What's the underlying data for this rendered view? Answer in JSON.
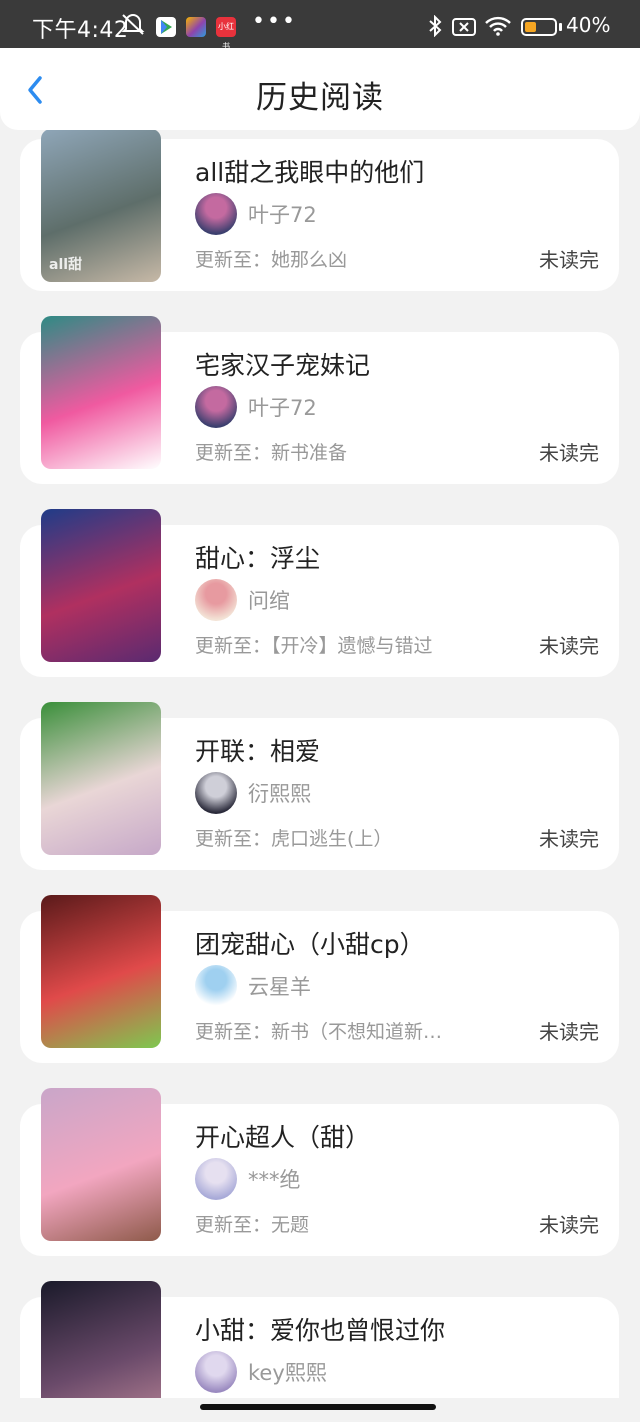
{
  "status_bar": {
    "time": "下午4:42",
    "battery_pct": "40%",
    "battery_level": 0.4,
    "mini_app_label": "小红书"
  },
  "header": {
    "title": "历史阅读"
  },
  "colors": {
    "accent": "#2d8cf0",
    "background": "#f2f2f2"
  },
  "books": [
    {
      "title": "all甜之我眼中的他们",
      "author": "叶子72",
      "update": "更新至：她那么凶",
      "status": "未读完",
      "cover": [
        "#8fa6b8",
        "#5e6e6a",
        "#c7b9a7"
      ],
      "cover_text": "all甜",
      "avatar": [
        "#3b3f6e",
        "#c46aa0"
      ]
    },
    {
      "title": "宅家汉子宠妹记",
      "author": "叶子72",
      "update": "更新至：新书准备",
      "status": "未读完",
      "cover": [
        "#2e8b84",
        "#f05aa0",
        "#ffffff"
      ],
      "cover_text": "",
      "avatar": [
        "#3b3f6e",
        "#c46aa0"
      ]
    },
    {
      "title": "甜心：浮尘",
      "author": "问绾",
      "update": "更新至：【开冷】遗憾与错过",
      "status": "未读完",
      "cover": [
        "#1f3c88",
        "#b03060",
        "#5a2a70"
      ],
      "cover_text": "",
      "avatar": [
        "#f3e3d6",
        "#e79aa0"
      ]
    },
    {
      "title": "开联：相爱",
      "author": "衍熙熙",
      "update": "更新至：虎口逃生(上）",
      "status": "未读完",
      "cover": [
        "#3a8f3a",
        "#e9d6d6",
        "#c6a8c8"
      ],
      "cover_text": "",
      "avatar": [
        "#2a2a3a",
        "#cfcfd8"
      ]
    },
    {
      "title": "团宠甜心（小甜cp）",
      "author": "云星羊",
      "update": "更新至：新书（不想知道新…",
      "status": "未读完",
      "cover": [
        "#5a1a1a",
        "#e04a4a",
        "#7ec850"
      ],
      "cover_text": "",
      "avatar": [
        "#ffffff",
        "#9fd0f0"
      ]
    },
    {
      "title": "开心超人（甜）",
      "author": "***绝",
      "update": "更新至：无题",
      "status": "未读完",
      "cover": [
        "#c9a6c9",
        "#f2a6c0",
        "#8e5a4a"
      ],
      "cover_text": "",
      "avatar": [
        "#a8aad8",
        "#e6e0f0"
      ]
    },
    {
      "title": "小甜：爱你也曾恨过你",
      "author": "key熙熙",
      "update": "",
      "status": "",
      "cover": [
        "#1a1a2a",
        "#6a4a6a",
        "#c08a9a"
      ],
      "cover_text": "",
      "avatar": [
        "#9a8ac0",
        "#e0d8ee"
      ]
    }
  ]
}
